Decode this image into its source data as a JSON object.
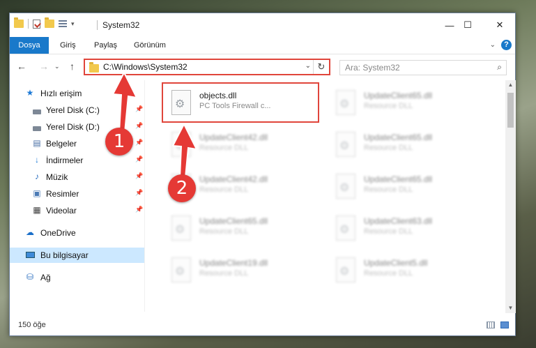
{
  "window": {
    "title": "System32",
    "controls": {
      "minimize": "—",
      "maximize": "☐",
      "close": "✕"
    }
  },
  "ribbon": {
    "tabs": [
      "Dosya",
      "Giriş",
      "Paylaş",
      "Görünüm"
    ],
    "help": "?"
  },
  "address": {
    "path": "C:\\Windows\\System32",
    "search_placeholder": "Ara: System32"
  },
  "sidebar": {
    "quick_access": "Hızlı erişim",
    "items": [
      {
        "label": "Yerel Disk (C:)",
        "icon": "drive-icon"
      },
      {
        "label": "Yerel Disk (D:)",
        "icon": "drive-icon"
      },
      {
        "label": "Belgeler",
        "icon": "documents-icon"
      },
      {
        "label": "İndirmeler",
        "icon": "downloads-icon"
      },
      {
        "label": "Müzik",
        "icon": "music-icon"
      },
      {
        "label": "Resimler",
        "icon": "pictures-icon"
      },
      {
        "label": "Videolar",
        "icon": "videos-icon"
      }
    ],
    "onedrive": "OneDrive",
    "this_pc": "Bu bilgisayar",
    "network": "Ağ"
  },
  "files": {
    "highlighted": {
      "name": "objects.dll",
      "desc": "PC Tools Firewall c..."
    },
    "others": [
      {
        "name": "UpdateClient65.dll",
        "desc": "Resource DLL"
      },
      {
        "name": "UpdateClient42.dll",
        "desc": "Resource DLL"
      },
      {
        "name": "UpdateClient65.dll",
        "desc": "Resource DLL"
      },
      {
        "name": "UpdateClient42.dll",
        "desc": "Resource DLL"
      },
      {
        "name": "UpdateClient65.dll",
        "desc": "Resource DLL"
      },
      {
        "name": "UpdateClient65.dll",
        "desc": "Resource DLL"
      },
      {
        "name": "UpdateClient63.dll",
        "desc": "Resource DLL"
      },
      {
        "name": "UpdateClient19.dll",
        "desc": "Resource DLL"
      },
      {
        "name": "UpdateClient5.dll",
        "desc": "Resource DLL"
      }
    ]
  },
  "status": {
    "count": "150 öğe"
  },
  "annotations": {
    "step1": "1",
    "step2": "2",
    "color": "#e53935"
  }
}
